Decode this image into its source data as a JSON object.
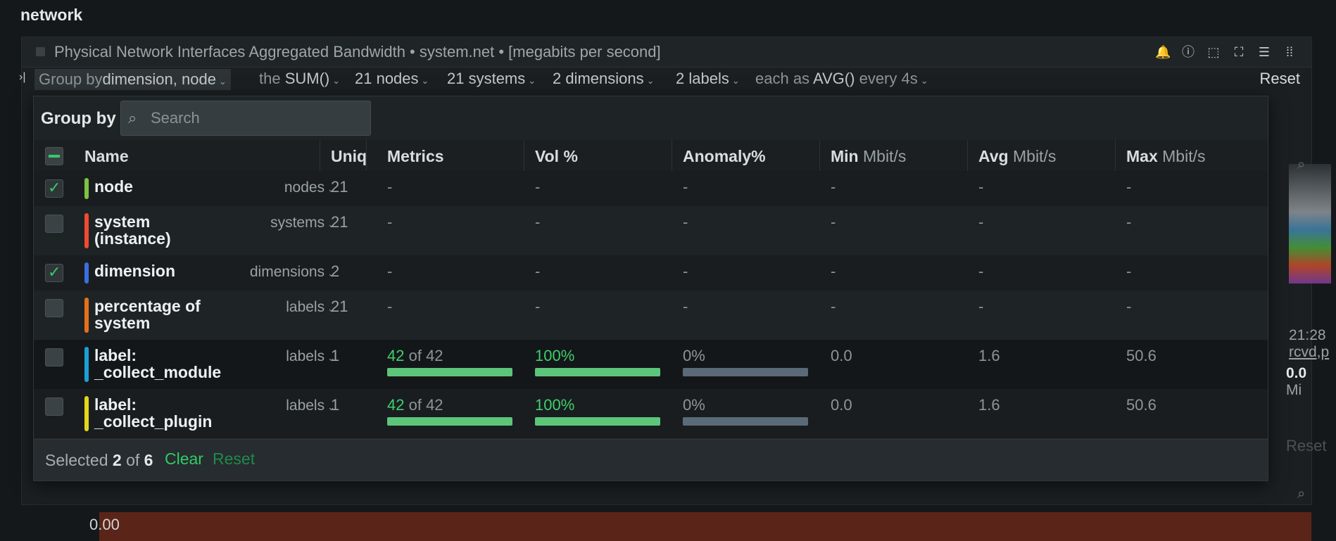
{
  "section": {
    "title": "network"
  },
  "chart": {
    "title": "Physical Network Interfaces Aggregated Bandwidth • system.net • [megabits per second]",
    "reset": "Reset",
    "background": {
      "axis_label": "megabits per second",
      "time": "21:28",
      "legend_fragment": "rcvd,p",
      "value_fragment": "0.0",
      "unit_fragment": "Mi",
      "zero": "0.00",
      "reset2": "Reset",
      "a_label": "a"
    }
  },
  "filters": {
    "group_by_label": "Group by",
    "group_by_value": "dimension, node",
    "the": "the",
    "agg": "SUM()",
    "nodes": "21 nodes",
    "systems": "21 systems",
    "dimensions": "2 dimensions",
    "labels": "2 labels",
    "each_as": "each as",
    "time_agg": "AVG()",
    "every": "every 4s"
  },
  "popover": {
    "label": "Group by",
    "search_placeholder": "Search",
    "columns": {
      "name": "Name",
      "uniq": "Uniq",
      "metrics": "Metrics",
      "vol": "Vol %",
      "anomaly": "Anomaly%",
      "min": "Min",
      "avg": "Avg",
      "max": "Max",
      "unit": "Mbit/s"
    },
    "rows": [
      {
        "checked": true,
        "color": "#7cc341",
        "name": "node",
        "type": "nodes",
        "uniq": "21",
        "metrics": "-",
        "vol": "-",
        "anomaly": "-",
        "min": "-",
        "avg": "-",
        "max": "-"
      },
      {
        "checked": false,
        "color": "#f04a33",
        "name": "system (instance)",
        "type": "systems",
        "uniq": "21",
        "metrics": "-",
        "vol": "-",
        "anomaly": "-",
        "min": "-",
        "avg": "-",
        "max": "-"
      },
      {
        "checked": true,
        "color": "#3a6fe0",
        "name": "dimension",
        "type": "dimensions",
        "uniq": "2",
        "metrics": "-",
        "vol": "-",
        "anomaly": "-",
        "min": "-",
        "avg": "-",
        "max": "-"
      },
      {
        "checked": false,
        "color": "#e5701c",
        "name": "percentage of system",
        "type": "labels",
        "uniq": "21",
        "metrics": "-",
        "vol": "-",
        "anomaly": "-",
        "min": "-",
        "avg": "-",
        "max": "-"
      },
      {
        "checked": false,
        "color": "#1aa0d6",
        "name": "label: _collect_module",
        "type": "labels",
        "uniq": "1",
        "metrics_count": "42",
        "metrics_of": "of 42",
        "metrics_fill": 1.0,
        "vol": "100%",
        "vol_fill": 1.0,
        "anomaly": "0%",
        "min": "0.0",
        "avg": "1.6",
        "max": "50.6"
      },
      {
        "checked": false,
        "color": "#e3d61a",
        "name": "label: _collect_plugin",
        "type": "labels",
        "uniq": "1",
        "metrics_count": "42",
        "metrics_of": "of 42",
        "metrics_fill": 1.0,
        "vol": "100%",
        "vol_fill": 1.0,
        "anomaly": "0%",
        "min": "0.0",
        "avg": "1.6",
        "max": "50.6"
      }
    ],
    "footer": {
      "selected_prefix": "Selected",
      "selected_count": "2",
      "of": "of",
      "total": "6",
      "clear": "Clear",
      "reset": "Reset"
    }
  }
}
